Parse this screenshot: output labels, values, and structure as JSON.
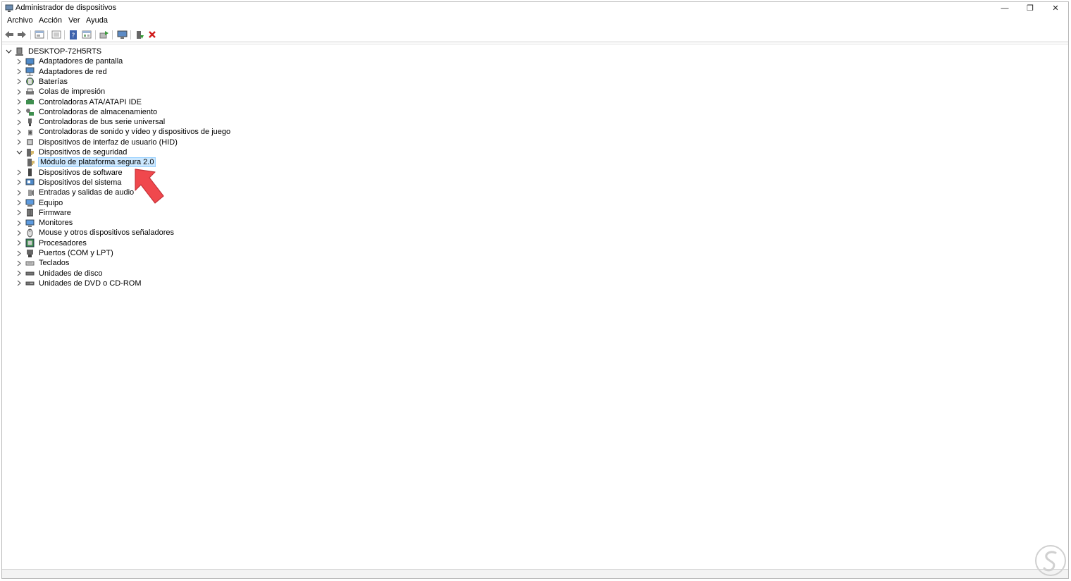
{
  "window": {
    "title": "Administrador de dispositivos",
    "controls": {
      "minimize": "—",
      "restore": "❐",
      "close": "✕"
    }
  },
  "menu": [
    "Archivo",
    "Acción",
    "Ver",
    "Ayuda"
  ],
  "toolbar": [
    "back-icon",
    "forward-icon",
    "properties-icon",
    "list-icon",
    "help-icon",
    "resources-icon",
    "update-driver-icon",
    "monitor-icon",
    "enable-device-icon",
    "uninstall-icon"
  ],
  "tree": {
    "root": "DESKTOP-72H5RTS",
    "items": [
      {
        "label": "Adaptadores de pantalla",
        "icon": "display-adapter-icon",
        "expanded": false
      },
      {
        "label": "Adaptadores de red",
        "icon": "network-adapter-icon",
        "expanded": false
      },
      {
        "label": "Baterías",
        "icon": "battery-icon",
        "expanded": false
      },
      {
        "label": "Colas de impresión",
        "icon": "printer-icon",
        "expanded": false
      },
      {
        "label": "Controladoras ATA/ATAPI IDE",
        "icon": "ide-controller-icon",
        "expanded": false
      },
      {
        "label": "Controladoras de almacenamiento",
        "icon": "storage-controller-icon",
        "expanded": false
      },
      {
        "label": "Controladoras de bus serie universal",
        "icon": "usb-icon",
        "expanded": false
      },
      {
        "label": "Controladoras de sonido y vídeo y dispositivos de juego",
        "icon": "sound-icon",
        "expanded": false
      },
      {
        "label": "Dispositivos de interfaz de usuario (HID)",
        "icon": "hid-icon",
        "expanded": false
      },
      {
        "label": "Dispositivos de seguridad",
        "icon": "security-device-icon",
        "expanded": true
      },
      {
        "label": "Módulo de plataforma segura 2.0",
        "icon": "tpm-icon",
        "child": true,
        "selected": true
      },
      {
        "label": "Dispositivos de software",
        "icon": "software-device-icon",
        "expanded": false
      },
      {
        "label": "Dispositivos del sistema",
        "icon": "system-device-icon",
        "expanded": false
      },
      {
        "label": "Entradas y salidas de audio",
        "icon": "audio-io-icon",
        "expanded": false
      },
      {
        "label": "Equipo",
        "icon": "computer-icon",
        "expanded": false
      },
      {
        "label": "Firmware",
        "icon": "firmware-icon",
        "expanded": false
      },
      {
        "label": "Monitores",
        "icon": "monitor-icon",
        "expanded": false
      },
      {
        "label": "Mouse y otros dispositivos señaladores",
        "icon": "mouse-icon",
        "expanded": false
      },
      {
        "label": "Procesadores",
        "icon": "processor-icon",
        "expanded": false
      },
      {
        "label": "Puertos (COM y LPT)",
        "icon": "port-icon",
        "expanded": false
      },
      {
        "label": "Teclados",
        "icon": "keyboard-icon",
        "expanded": false
      },
      {
        "label": "Unidades de disco",
        "icon": "disk-drive-icon",
        "expanded": false
      },
      {
        "label": "Unidades de DVD o CD-ROM",
        "icon": "dvd-drive-icon",
        "expanded": false
      }
    ]
  },
  "colors": {
    "selection_bg": "#cce8ff",
    "selection_border": "#99d1ff",
    "arrow": "#f0484d",
    "watermark": "#d0d0d0"
  }
}
